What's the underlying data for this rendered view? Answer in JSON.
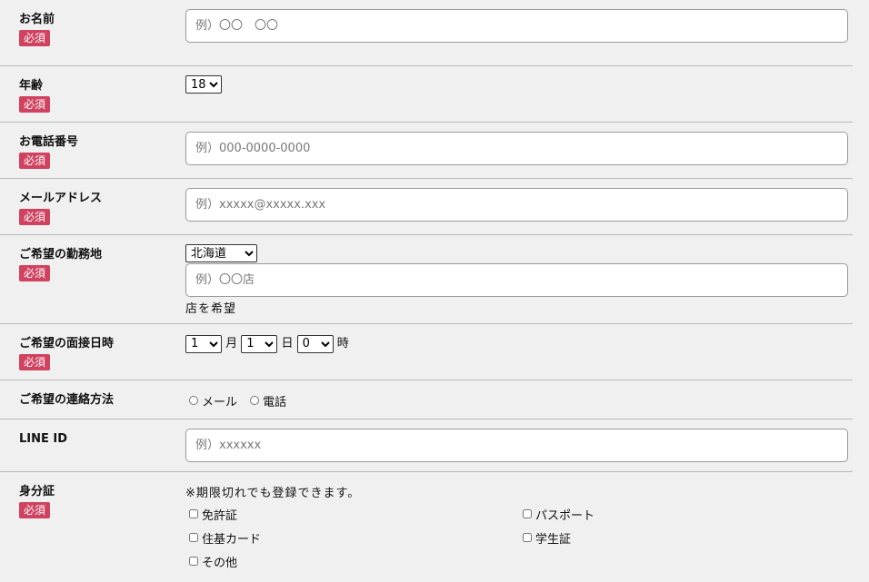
{
  "required_badge": "必須",
  "name": {
    "label": "お名前",
    "placeholder": "例）〇〇　〇〇"
  },
  "age": {
    "label": "年齢",
    "selected": "18"
  },
  "phone": {
    "label": "お電話番号",
    "placeholder": "例）000-0000-0000"
  },
  "email": {
    "label": "メールアドレス",
    "placeholder": "例）xxxxx@xxxxx.xxx"
  },
  "work_location": {
    "label": "ご希望の勤務地",
    "prefecture_selected": "北海道",
    "store_placeholder": "例）〇〇店",
    "suffix": "店を希望"
  },
  "interview": {
    "label": "ご希望の面接日時",
    "month_selected": "1",
    "month_unit": "月",
    "day_selected": "1",
    "day_unit": "日",
    "hour_selected": "0",
    "hour_unit": "時"
  },
  "contact": {
    "label": "ご希望の連絡方法",
    "options": [
      "メール",
      "電話"
    ]
  },
  "line": {
    "label": "LINE ID",
    "placeholder": "例）xxxxxx"
  },
  "id_doc": {
    "label": "身分証",
    "note": "※期限切れでも登録できます。",
    "options": [
      "免許証",
      "パスポート",
      "住基カード",
      "学生証",
      "その他"
    ]
  }
}
